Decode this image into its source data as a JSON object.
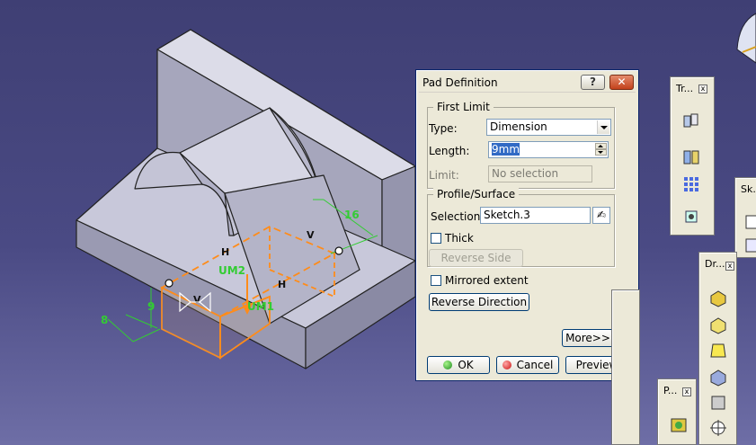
{
  "viewport": {
    "dimensions": [
      "16",
      "9",
      "8"
    ],
    "sketch_labels": {
      "h1": "H",
      "h2": "H",
      "v1": "V",
      "v2": "V",
      "um2": "UM2",
      "um1": "UM1"
    }
  },
  "dialog": {
    "title": "Pad Definition",
    "help_label": "?",
    "close_label": "✕",
    "first_limit": {
      "legend": "First Limit",
      "type_label": "Type:",
      "type_value": "Dimension",
      "length_label": "Length:",
      "length_value": "9mm",
      "limit_label": "Limit:",
      "limit_value": "No selection"
    },
    "profile_surface": {
      "legend": "Profile/Surface",
      "selection_label": "Selection:",
      "selection_value": "Sketch.3",
      "thick_label": "Thick",
      "reverse_side_label": "Reverse Side"
    },
    "mirrored_extent_label": "Mirrored extent",
    "reverse_direction_label": "Reverse Direction",
    "more_label": "More>>",
    "ok_label": "OK",
    "cancel_label": "Cancel",
    "preview_label": "Preview"
  },
  "toolbars": {
    "tr_title": "Tr...",
    "sk_title": "Sk...",
    "dr_title": "Dr...",
    "p_title": "P...",
    "close_glyph": "x"
  },
  "colors": {
    "background": "#45457d",
    "part_face": "#c9c9d8",
    "sketch_orange": "#ff8c1a",
    "dimension_green": "#33cc33"
  }
}
